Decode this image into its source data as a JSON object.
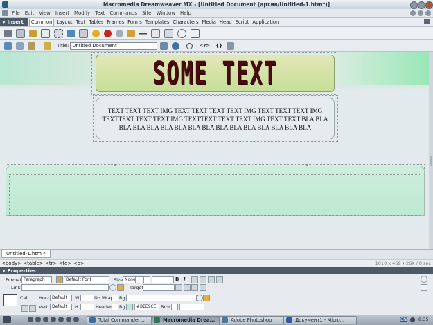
{
  "window": {
    "title": "Macromedia Dreamweaver MX - [Untitled Document (архив/Untitled-1.htm*)]"
  },
  "menu": [
    "File",
    "Edit",
    "View",
    "Insert",
    "Modify",
    "Text",
    "Commands",
    "Site",
    "Window",
    "Help"
  ],
  "insert_panel": {
    "label": "Insert",
    "tabs": [
      "Common",
      "Layout",
      "Text",
      "Tables",
      "Frames",
      "Forms",
      "Templates",
      "Characters",
      "Media",
      "Head",
      "Script",
      "Application"
    ],
    "active_tab": "Common"
  },
  "doc_toolbar": {
    "title_label": "Title:",
    "title_value": "Untitled Document",
    "code_icon_text": "<?>",
    "braces_text": "{}"
  },
  "page": {
    "header_text": "SOME TEXT",
    "content_text": "TEXT TEXT TEXT IMG TEXT TEXT TEXT TEXT IMG TEXT TEXT TEXT IMG TEXTTEXT TEXT TEXT IMG TEXTTEXT TEXT TEXT IMG TEXT TEXT BLA BLA BLA BLA BLA BLA BLA BLA BLA BLA BLA BLA BLA BLA BLA BLA"
  },
  "document_tab": "Untitled-1.htm *",
  "status": {
    "tag_selector": "<body> <table> <tr> <td> <p>",
    "size_info": "1010 x 469 ▾ 26K / 8 sec"
  },
  "properties": {
    "title": "Properties",
    "format_label": "Format",
    "format_value": "Paragraph",
    "font_value": "Default Font",
    "size_label": "Size",
    "size_value": "None",
    "link_label": "Link",
    "target_label": "Target",
    "cell_label": "Cell",
    "horz_label": "Horz",
    "horz_value": "Default",
    "vert_label": "Vert",
    "vert_value": "Default",
    "w_label": "W",
    "h_label": "H",
    "nowrap_label": "No Wrap",
    "header_label": "Header",
    "bg_label": "Bg",
    "bg_value": "#BEE9CE",
    "brdr_label": "Brdr",
    "bold": "B",
    "italic": "I"
  },
  "taskbar": {
    "tasks": [
      "Total Commander ...",
      "Macromedia Drea...",
      "Adobe Photoshop",
      "Документ1 - Micro..."
    ],
    "lang": "EN",
    "clock": "8:35"
  },
  "colors": {
    "bg_swatch": "#BEE9CE"
  }
}
